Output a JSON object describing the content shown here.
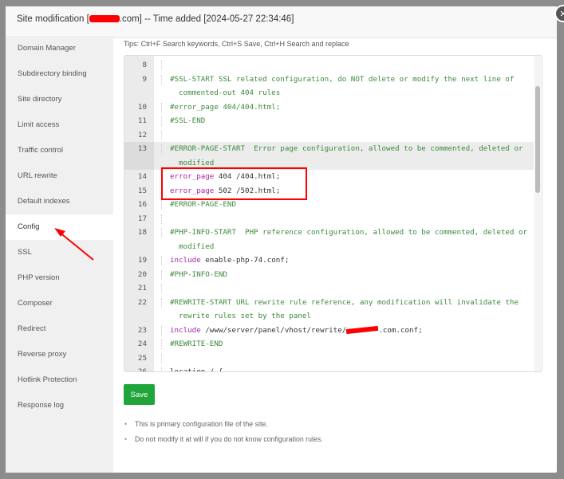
{
  "title": {
    "prefix": "Site modification [",
    "suffix": ".com] -- Time added [2024-05-27 22:34:46]"
  },
  "close_label": "×",
  "sidebar": [
    "Domain Manager",
    "Subdirectory binding",
    "Site directory",
    "Limit access",
    "Traffic control",
    "URL rewrite",
    "Default indexes",
    "Config",
    "SSL",
    "PHP version",
    "Composer",
    "Redirect",
    "Reverse proxy",
    "Hotlink Protection",
    "Response log"
  ],
  "active_item": "Config",
  "tips": "Tips:  Ctrl+F Search keywords,  Ctrl+S Save,  Ctrl+H Search and replace",
  "lines": [
    {
      "n": "8",
      "s": []
    },
    {
      "n": "9",
      "s": [
        [
          "cm",
          "#SSL-START SSL related configuration, do NOT delete or modify the next line of"
        ]
      ],
      "c": "commented-out 404 rules"
    },
    {
      "n": "10",
      "s": [
        [
          "cm",
          "#error_page 404/404.html;"
        ]
      ]
    },
    {
      "n": "11",
      "s": [
        [
          "cm",
          "#SSL-END"
        ]
      ]
    },
    {
      "n": "12",
      "s": []
    },
    {
      "n": "13",
      "s": [
        [
          "cm",
          "#ERROR-PAGE-START  Error page configuration, allowed to be commented, deleted or"
        ]
      ],
      "c": "modified",
      "active": true
    },
    {
      "n": "14",
      "s": [
        [
          "kw",
          "error_page"
        ],
        [
          "tx",
          " 404 /404.html;"
        ]
      ]
    },
    {
      "n": "15",
      "s": [
        [
          "kw",
          "error_page"
        ],
        [
          "tx",
          " 502 /502.html;"
        ]
      ]
    },
    {
      "n": "16",
      "s": [
        [
          "cm",
          "#ERROR-PAGE-END"
        ]
      ]
    },
    {
      "n": "17",
      "s": []
    },
    {
      "n": "18",
      "s": [
        [
          "cm",
          "#PHP-INFO-START  PHP reference configuration, allowed to be commented, deleted or"
        ]
      ],
      "c": "modified"
    },
    {
      "n": "19",
      "s": [
        [
          "kw",
          "include"
        ],
        [
          "tx",
          " enable-php-74.conf;"
        ]
      ]
    },
    {
      "n": "20",
      "s": [
        [
          "cm",
          "#PHP-INFO-END"
        ]
      ]
    },
    {
      "n": "21",
      "s": []
    },
    {
      "n": "22",
      "s": [
        [
          "cm",
          "#REWRITE-START URL rewrite rule reference, any modification will invalidate the"
        ]
      ],
      "c": "rewrite rules set by the panel"
    },
    {
      "n": "23",
      "s": [
        [
          "kw",
          "include"
        ],
        [
          "tx",
          " /www/server/panel/vhost/rewrite/"
        ],
        [
          "redact",
          ""
        ],
        [
          "tx",
          ".com.conf;"
        ]
      ]
    },
    {
      "n": "24",
      "s": [
        [
          "cm",
          "#REWRITE-END"
        ]
      ]
    },
    {
      "n": "25",
      "s": []
    },
    {
      "n": "26",
      "s": [
        [
          "tx",
          "location / {"
        ]
      ]
    }
  ],
  "save_label": "Save",
  "notes": [
    "This is primary configuration file of the site.",
    "Do not modify it at will if you do not know configuration rules."
  ],
  "colors": {
    "save": "#20a53a",
    "comment": "#3d8b3d",
    "keyword": "#a626a4",
    "annotation": "#ff0000"
  }
}
